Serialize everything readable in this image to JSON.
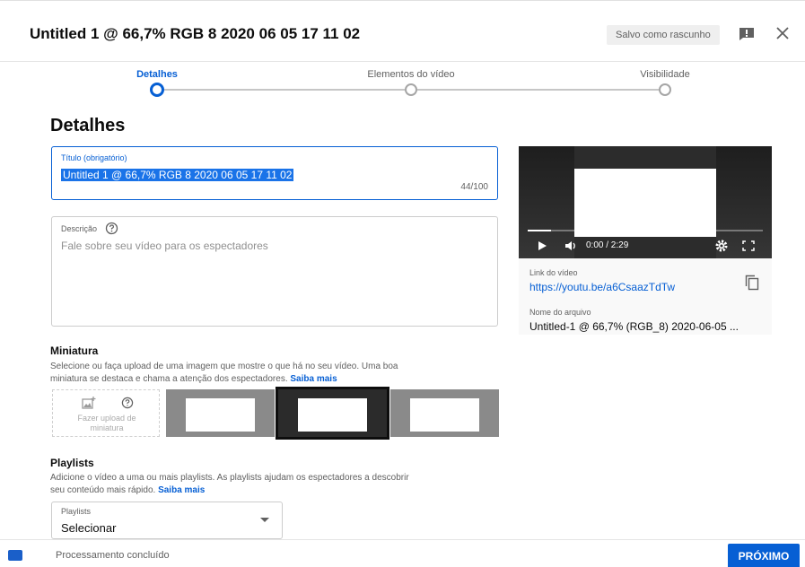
{
  "header": {
    "title": "Untitled 1 @ 66,7% RGB 8 2020 06 05 17 11 02",
    "draft_status": "Salvo como rascunho",
    "feedback_icon": "feedback-icon",
    "close_icon": "close-icon"
  },
  "stepper": {
    "steps": [
      {
        "label": "Detalhes",
        "active": true
      },
      {
        "label": "Elementos do vídeo",
        "active": false
      },
      {
        "label": "Visibilidade",
        "active": false
      }
    ]
  },
  "details": {
    "heading": "Detalhes",
    "title_field": {
      "label": "Título (obrigatório)",
      "value": "Untitled 1 @ 66,7% RGB 8 2020 06 05 17 11 02",
      "char_count": "44/100"
    },
    "description_field": {
      "label": "Descrição",
      "placeholder": "Fale sobre seu vídeo para os espectadores"
    }
  },
  "video": {
    "time": "0:00 / 2:29",
    "progress_fraction": 0.1,
    "link_label": "Link do vídeo",
    "link": "https://youtu.be/a6CsaazTdTw",
    "file_label": "Nome do arquivo",
    "file_name": "Untitled-1 @ 66,7% (RGB_8) 2020-06-05 ..."
  },
  "thumbnail": {
    "heading": "Miniatura",
    "description_line1": "Selecione ou faça upload de uma imagem que mostre o que há no seu vídeo. Uma boa",
    "description_line2": "miniatura se destaca e chama a atenção dos espectadores.",
    "learn_more": "Saiba mais",
    "upload_label_line1": "Fazer upload de",
    "upload_label_line2": "miniatura",
    "selected_index": 1
  },
  "playlists": {
    "heading": "Playlists",
    "description_line1": "Adicione o vídeo a uma ou mais playlists. As playlists ajudam os espectadores a descobrir",
    "description_line2": "seu conteúdo mais rápido.",
    "learn_more": "Saiba mais",
    "select_label": "Playlists",
    "select_value": "Selecionar"
  },
  "footer": {
    "status": "Processamento concluído",
    "next_label": "PRÓXIMO"
  },
  "colors": {
    "accent": "#065fd4",
    "text": "#0d0d0d",
    "secondary_text": "#606060"
  }
}
